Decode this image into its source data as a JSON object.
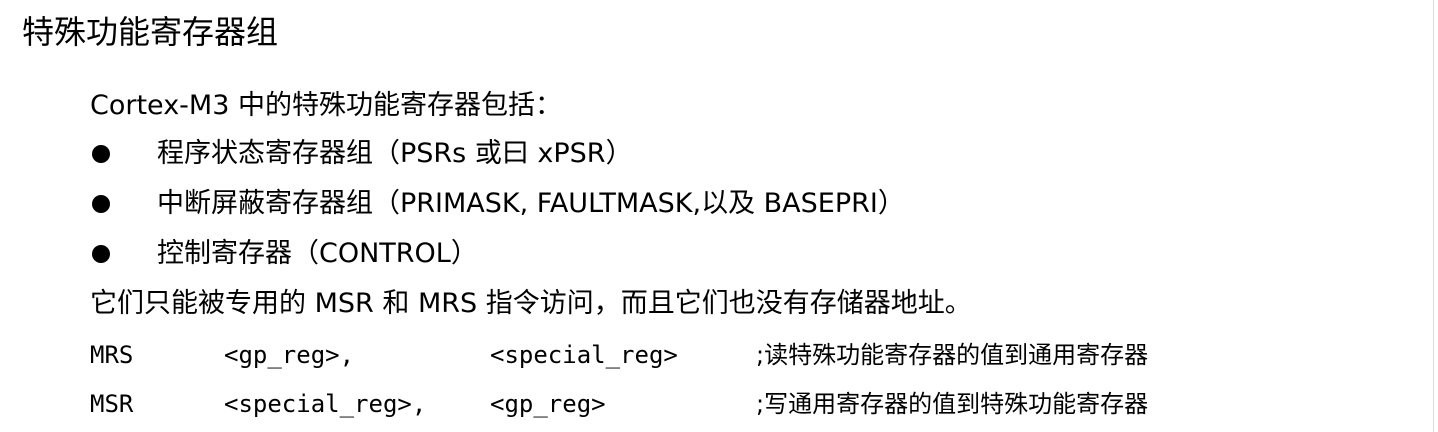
{
  "heading": "特殊功能寄存器组",
  "intro": "Cortex-M3 中的特殊功能寄存器包括：",
  "bullets": [
    "程序状态寄存器组（PSRs 或曰 xPSR）",
    "中断屏蔽寄存器组（PRIMASK, FAULTMASK,以及 BASEPRI）",
    "控制寄存器（CONTROL）"
  ],
  "note": "它们只能被专用的 MSR 和 MRS 指令访问，而且它们也没有存储器地址。",
  "code_lines": [
    {
      "instruction": "MRS",
      "operand1": "<gp_reg>,",
      "operand2": "<special_reg>",
      "comment": ";读特殊功能寄存器的值到通用寄存器"
    },
    {
      "instruction": "MSR",
      "operand1": "<special_reg>,",
      "operand2": "<gp_reg>",
      "comment": ";写通用寄存器的值到特殊功能寄存器"
    }
  ]
}
